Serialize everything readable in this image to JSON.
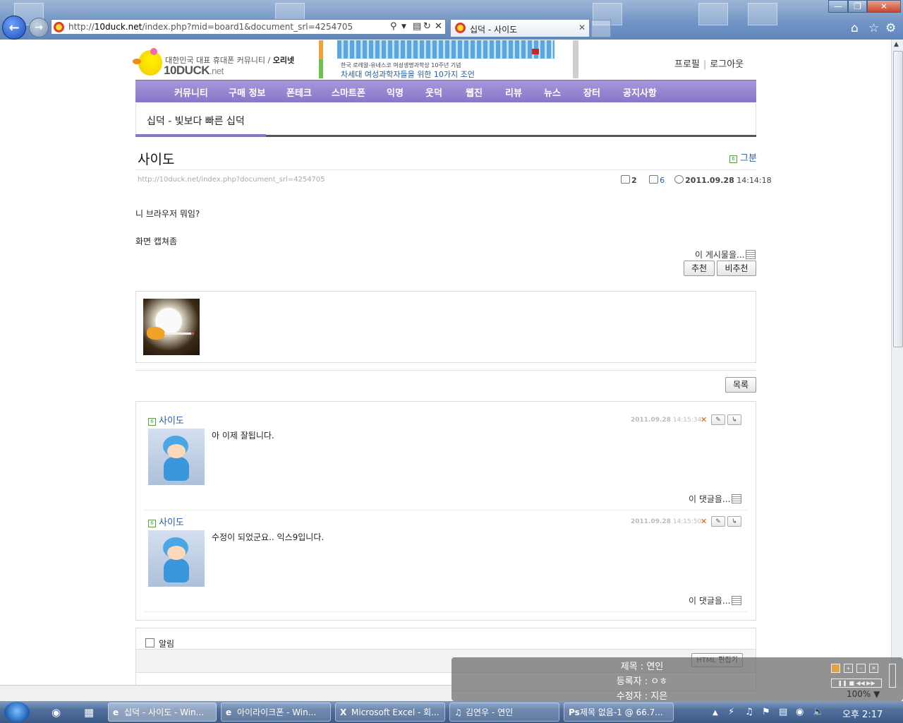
{
  "browser": {
    "url_prefix": "http://",
    "url_host": "10duck.net",
    "url_path": "/index.php?mid=board1&document_srl=4254705",
    "tab_title": "십덕 - 사이도",
    "zoom": "100%"
  },
  "site": {
    "tagline": "대한민국 대표 휴대폰 커뮤니티",
    "tagline_sub": "오리넷",
    "logo_text": "10DUCK",
    "logo_suffix": ".net",
    "banner_small": "한국 로레알-유네스코 여성생명과학상 10주년 기념",
    "banner_text": "차세대 여성과학자들을 위한 10가지 조언",
    "profile_link": "프로필",
    "logout_link": "로그아웃",
    "nav": [
      "커뮤니티",
      "구매 정보",
      "폰테크",
      "스마트폰",
      "익명",
      "웃덕",
      "웹진",
      "리뷰",
      "뉴스",
      "장터",
      "공지사항"
    ],
    "board_title": "십덕 - 빛보다 빠른 십덕"
  },
  "document": {
    "title": "사이도",
    "author_level": "6",
    "author": "그분",
    "url": "http://10duck.net/index.php?document_srl=4254705",
    "comment_count": "2",
    "read_count": "6",
    "date": "2011.09.28",
    "time": "14:14:18",
    "body_line1": "니 브라우저 뭐임?",
    "body_line2": "화면 캡쳐좀",
    "more_label": "이 게시물을...",
    "recommend": "추천",
    "not_recommend": "비추천",
    "list_button": "목록"
  },
  "comments": [
    {
      "level": "6",
      "author": "사이도",
      "date": "2011.09.28",
      "time": "14:15:34",
      "text": "아 이제 잘됩니다.",
      "more": "이 댓글을..."
    },
    {
      "level": "6",
      "author": "사이도",
      "date": "2011.09.28",
      "time": "14:15:50",
      "text": "수정이 되었군요.. 익스9입니다.",
      "more": "이 댓글을..."
    }
  ],
  "write": {
    "notify_label": "알림",
    "html_editor": "HTML 편집기"
  },
  "media": {
    "title_line": "제목 : 연인",
    "registrant_line": "등록자 : ㅇㅎ",
    "editor_line": "수정자 : 지은"
  },
  "taskbar": {
    "items": [
      {
        "icon": "ie-icon",
        "label": "십덕 - 사이도 - Win..."
      },
      {
        "icon": "ie-icon",
        "label": "아이라이크폰 - Win..."
      },
      {
        "icon": "excel-icon",
        "label": "Microsoft Excel - 회..."
      },
      {
        "icon": "music-icon",
        "label": "김연우 - 연인"
      },
      {
        "icon": "photoshop-icon",
        "label": "제목 없음-1 @ 66.7..."
      }
    ],
    "clock": "오후 2:17"
  },
  "colors": {
    "nav_purple": "#8a75c9",
    "link_blue": "#245ea8",
    "taskbar": "#4f6f9c"
  }
}
